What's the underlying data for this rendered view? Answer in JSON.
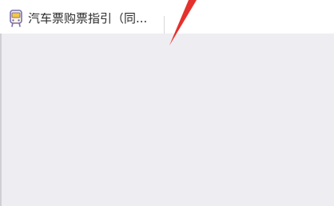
{
  "header": {
    "title": "汽车票购票指引（同...",
    "icon": "bus-icon"
  },
  "colors": {
    "background": "#eeedf2",
    "bar": "#ffffff",
    "annotation": "#e5312b",
    "icon_stroke": "#7a6fb0",
    "icon_fill": "#f5c842"
  }
}
